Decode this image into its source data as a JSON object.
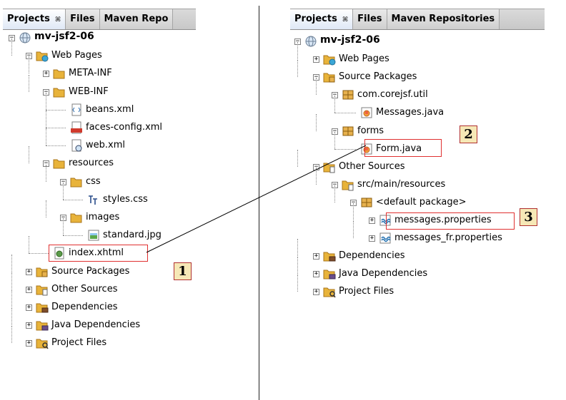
{
  "left_panel": {
    "tabs": [
      {
        "label": "Projects",
        "close": "⌘",
        "active": true
      },
      {
        "label": "Files",
        "close": "",
        "active": false
      },
      {
        "label": "Maven Repo",
        "close": "",
        "active": false
      }
    ],
    "tree": [
      {
        "label": "mv-jsf2-06",
        "icon": "globe-project-icon",
        "bold": true
      },
      {
        "label": "Web Pages",
        "icon": "web-folder-icon"
      },
      {
        "label": "META-INF",
        "icon": "folder-icon"
      },
      {
        "label": "WEB-INF",
        "icon": "folder-icon"
      },
      {
        "label": "beans.xml",
        "icon": "xml-file-icon"
      },
      {
        "label": "faces-config.xml",
        "icon": "jsf-config-icon"
      },
      {
        "label": "web.xml",
        "icon": "web-xml-icon"
      },
      {
        "label": "resources",
        "icon": "folder-icon"
      },
      {
        "label": "css",
        "icon": "folder-icon"
      },
      {
        "label": "styles.css",
        "icon": "css-file-icon"
      },
      {
        "label": "images",
        "icon": "folder-icon"
      },
      {
        "label": "standard.jpg",
        "icon": "image-file-icon"
      },
      {
        "label": "index.xhtml",
        "icon": "xhtml-file-icon"
      },
      {
        "label": "Source Packages",
        "icon": "source-packages-icon"
      },
      {
        "label": "Other Sources",
        "icon": "other-sources-icon"
      },
      {
        "label": "Dependencies",
        "icon": "dependencies-icon"
      },
      {
        "label": "Java Dependencies",
        "icon": "java-dependencies-icon"
      },
      {
        "label": "Project Files",
        "icon": "project-files-icon"
      }
    ]
  },
  "right_panel": {
    "tabs": [
      {
        "label": "Projects",
        "close": "⌘",
        "active": true
      },
      {
        "label": "Files",
        "close": "",
        "active": false
      },
      {
        "label": "Maven Repositories",
        "close": "",
        "active": false
      }
    ],
    "tree": [
      {
        "label": "mv-jsf2-06",
        "icon": "globe-project-icon",
        "bold": true
      },
      {
        "label": "Web Pages",
        "icon": "web-folder-icon"
      },
      {
        "label": "Source Packages",
        "icon": "source-packages-icon"
      },
      {
        "label": "com.corejsf.util",
        "icon": "package-icon"
      },
      {
        "label": "Messages.java",
        "icon": "java-file-icon"
      },
      {
        "label": "forms",
        "icon": "package-icon"
      },
      {
        "label": "Form.java",
        "icon": "java-file-icon"
      },
      {
        "label": "Other Sources",
        "icon": "other-sources-icon"
      },
      {
        "label": "src/main/resources",
        "icon": "resources-folder-icon"
      },
      {
        "label": "<default package>",
        "icon": "package-icon"
      },
      {
        "label": "messages.properties",
        "icon": "properties-file-icon"
      },
      {
        "label": "messages_fr.properties",
        "icon": "properties-file-icon"
      },
      {
        "label": "Dependencies",
        "icon": "dependencies-icon"
      },
      {
        "label": "Java Dependencies",
        "icon": "java-dependencies-icon"
      },
      {
        "label": "Project Files",
        "icon": "project-files-icon"
      }
    ]
  },
  "callouts": [
    "1",
    "2",
    "3"
  ],
  "colors": {
    "highlight_border": "#e03030",
    "callout_fill": "#f6e8b6",
    "folder": "#e8b33a",
    "package": "#e7b14d"
  }
}
